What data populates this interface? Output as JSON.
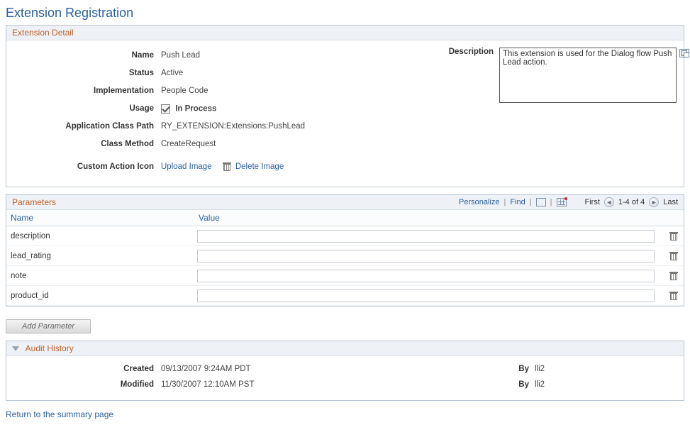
{
  "page": {
    "title": "Extension Registration"
  },
  "detail": {
    "box_title": "Extension Detail",
    "labels": {
      "name": "Name",
      "status": "Status",
      "implementation": "Implementation",
      "usage": "Usage",
      "app_class_path": "Application Class Path",
      "class_method": "Class Method",
      "custom_icon": "Custom Action Icon",
      "description": "Description"
    },
    "values": {
      "name": "Push Lead",
      "status": "Active",
      "implementation": "People Code",
      "usage": "In Process",
      "app_class_path": "RY_EXTENSION:Extensions:PushLead",
      "class_method": "CreateRequest",
      "description": "This extension is used for the Dialog flow Push Lead action."
    },
    "actions": {
      "upload_image": "Upload Image",
      "delete_image": "Delete Image"
    }
  },
  "parameters": {
    "box_title": "Parameters",
    "tools": {
      "personalize": "Personalize",
      "find": "Find",
      "first": "First",
      "range": "1-4 of 4",
      "last": "Last"
    },
    "columns": {
      "name": "Name",
      "value": "Value"
    },
    "rows": [
      {
        "name": "description",
        "value": ""
      },
      {
        "name": "lead_rating",
        "value": ""
      },
      {
        "name": "note",
        "value": ""
      },
      {
        "name": "product_id",
        "value": ""
      }
    ],
    "add_button": "Add Parameter"
  },
  "audit": {
    "box_title": "Audit History",
    "labels": {
      "created": "Created",
      "modified": "Modified",
      "by": "By"
    },
    "created": {
      "datetime": "09/13/2007  9:24AM PDT",
      "by": "lli2"
    },
    "modified": {
      "datetime": "11/30/2007 12:10AM PST",
      "by": "lli2"
    }
  },
  "footer": {
    "return_link": "Return to the summary page"
  }
}
